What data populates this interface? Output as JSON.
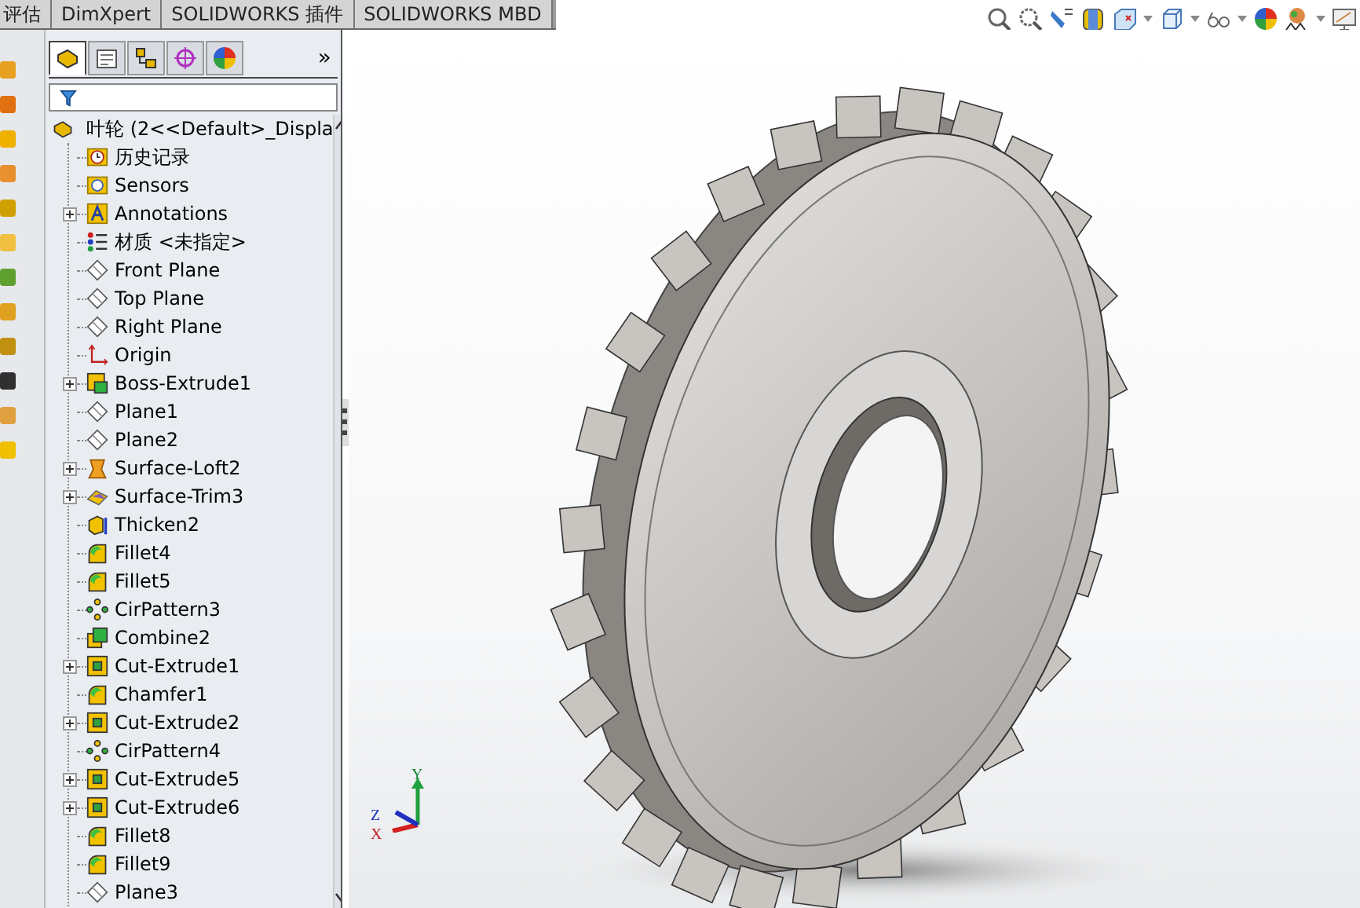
{
  "command_tabs": [
    {
      "label": "评估"
    },
    {
      "label": "DimXpert"
    },
    {
      "label": "SOLIDWORKS 插件"
    },
    {
      "label": "SOLIDWORKS MBD"
    }
  ],
  "panel_tabs": [
    {
      "kind": "feature-tree",
      "selected": true
    },
    {
      "kind": "property",
      "selected": false
    },
    {
      "kind": "config",
      "selected": false
    },
    {
      "kind": "dimxpert",
      "selected": false
    },
    {
      "kind": "display",
      "selected": false
    }
  ],
  "panel_more": "»",
  "tree": {
    "label": "叶轮  (2<<Default>_Displa",
    "children": [
      {
        "label": "历史记录",
        "kind": "history",
        "has_children": false
      },
      {
        "label": "Sensors",
        "kind": "sensors",
        "has_children": false
      },
      {
        "label": "Annotations",
        "kind": "annotations",
        "has_children": true
      },
      {
        "label": "材质 <未指定>",
        "kind": "material",
        "has_children": false
      },
      {
        "label": "Front Plane",
        "kind": "plane",
        "has_children": false
      },
      {
        "label": "Top Plane",
        "kind": "plane",
        "has_children": false
      },
      {
        "label": "Right Plane",
        "kind": "plane",
        "has_children": false
      },
      {
        "label": "Origin",
        "kind": "origin",
        "has_children": false
      },
      {
        "label": "Boss-Extrude1",
        "kind": "boss",
        "has_children": true
      },
      {
        "label": "Plane1",
        "kind": "plane",
        "has_children": false
      },
      {
        "label": "Plane2",
        "kind": "plane",
        "has_children": false
      },
      {
        "label": "Surface-Loft2",
        "kind": "loft",
        "has_children": true
      },
      {
        "label": "Surface-Trim3",
        "kind": "trim",
        "has_children": true
      },
      {
        "label": "Thicken2",
        "kind": "thicken",
        "has_children": false
      },
      {
        "label": "Fillet4",
        "kind": "fillet",
        "has_children": false
      },
      {
        "label": "Fillet5",
        "kind": "fillet",
        "has_children": false
      },
      {
        "label": "CirPattern3",
        "kind": "pattern",
        "has_children": false
      },
      {
        "label": "Combine2",
        "kind": "combine",
        "has_children": false
      },
      {
        "label": "Cut-Extrude1",
        "kind": "cut",
        "has_children": true
      },
      {
        "label": "Chamfer1",
        "kind": "fillet",
        "has_children": false
      },
      {
        "label": "Cut-Extrude2",
        "kind": "cut",
        "has_children": true
      },
      {
        "label": "CirPattern4",
        "kind": "pattern",
        "has_children": false
      },
      {
        "label": "Cut-Extrude5",
        "kind": "cut",
        "has_children": true
      },
      {
        "label": "Cut-Extrude6",
        "kind": "cut",
        "has_children": true
      },
      {
        "label": "Fillet8",
        "kind": "fillet",
        "has_children": false
      },
      {
        "label": "Fillet9",
        "kind": "fillet",
        "has_children": false
      },
      {
        "label": "Plane3",
        "kind": "plane",
        "has_children": false
      }
    ]
  },
  "triad": {
    "x": "X",
    "y": "Y",
    "z": "Z"
  }
}
